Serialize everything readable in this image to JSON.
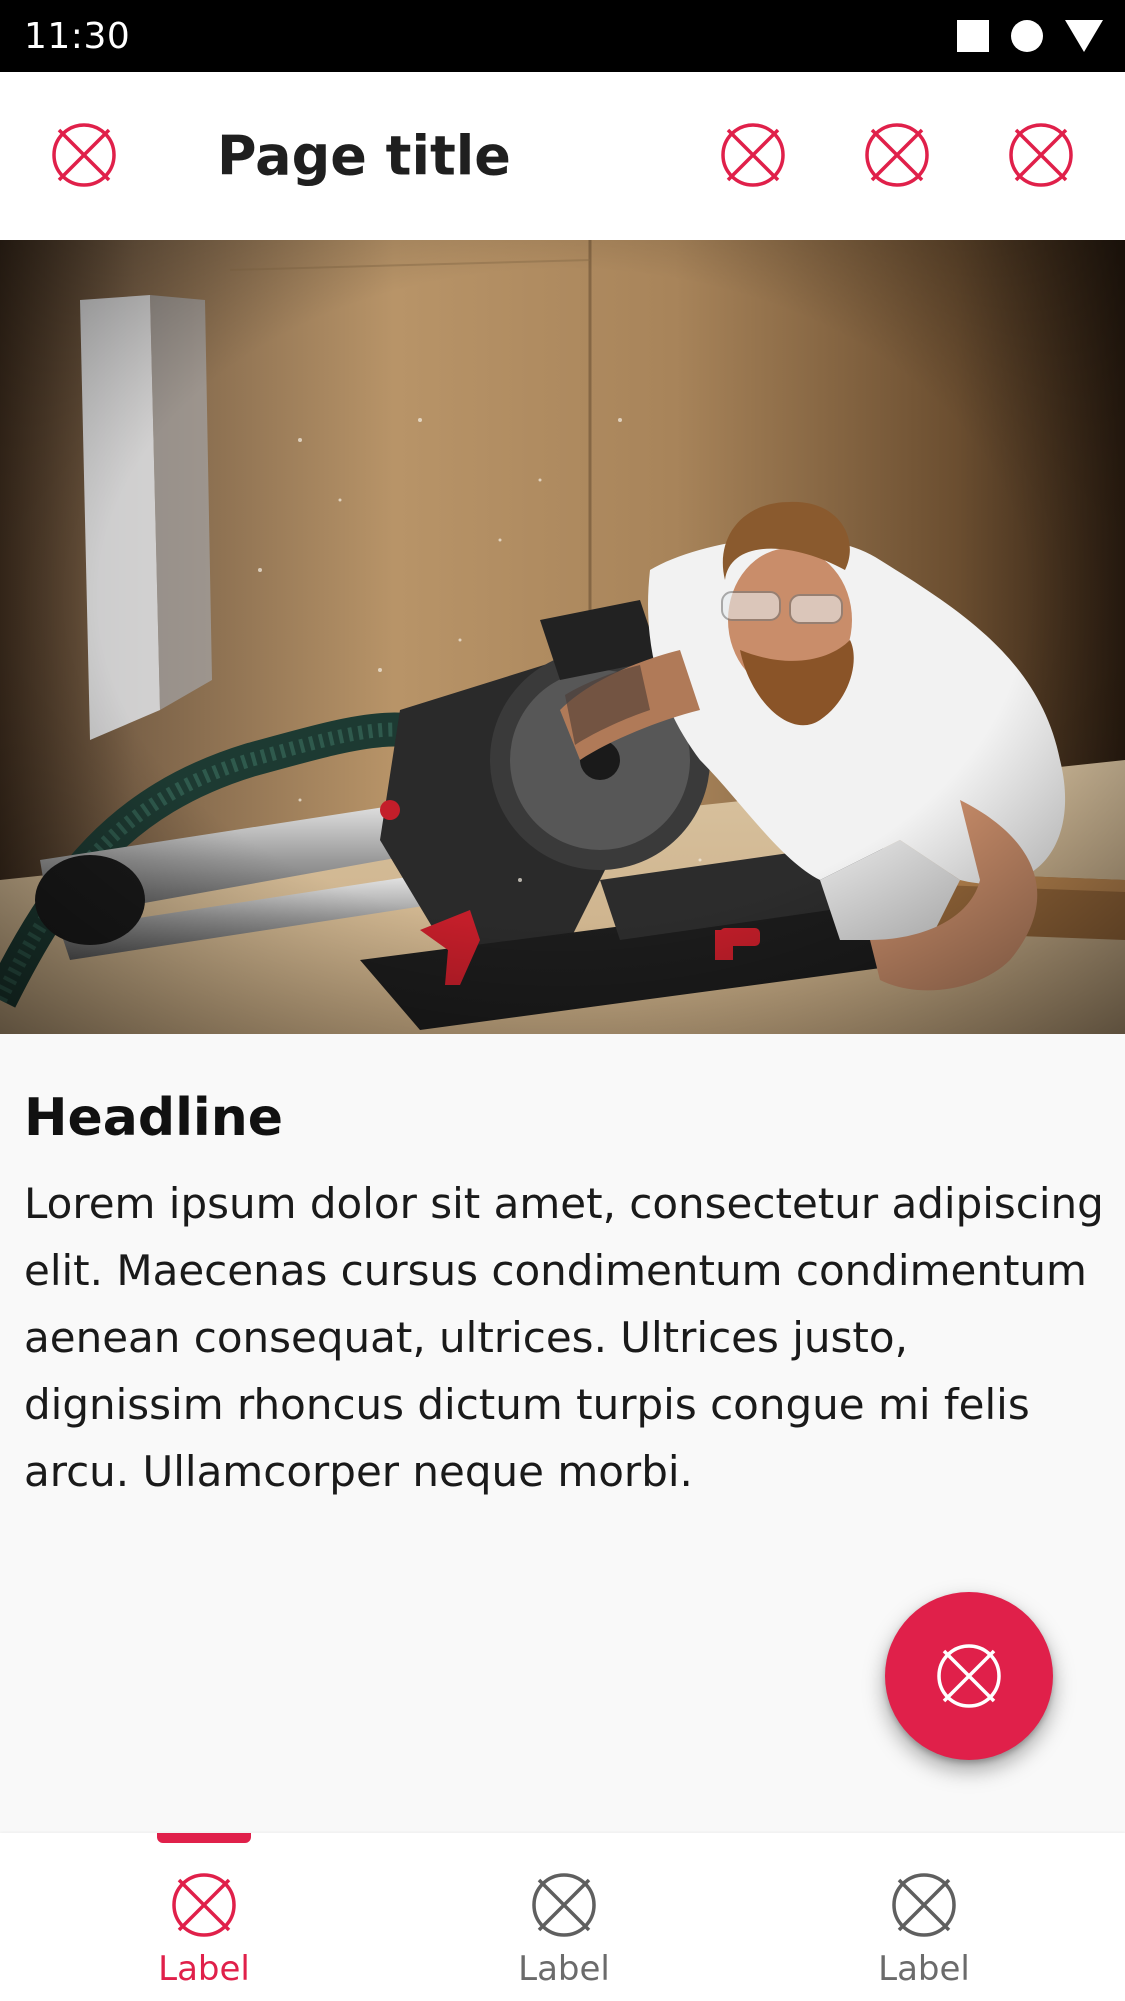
{
  "status_bar": {
    "time": "11:30"
  },
  "app_bar": {
    "title": "Page title",
    "icons": [
      "placeholder-icon",
      "placeholder-icon",
      "placeholder-icon",
      "placeholder-icon"
    ]
  },
  "hero": {
    "icon": "hero-photo-image"
  },
  "content": {
    "headline": "Headline",
    "body": "Lorem ipsum dolor sit amet, consectetur adipiscing elit. Maecenas cursus condimentum condimentum aenean consequat, ultrices. Ultrices justo, dignissim rhoncus dictum turpis congue mi felis arcu. Ullamcorper neque morbi."
  },
  "fab": {
    "icon": "placeholder-icon"
  },
  "bottom_nav": {
    "items": [
      {
        "label": "Label",
        "active": true
      },
      {
        "label": "Label",
        "active": false
      },
      {
        "label": "Label",
        "active": false
      }
    ]
  },
  "colors": {
    "accent": "#e0204a",
    "inactive": "#6b6b6b",
    "status_bar": "#000000",
    "background": "#f9f9f9"
  }
}
